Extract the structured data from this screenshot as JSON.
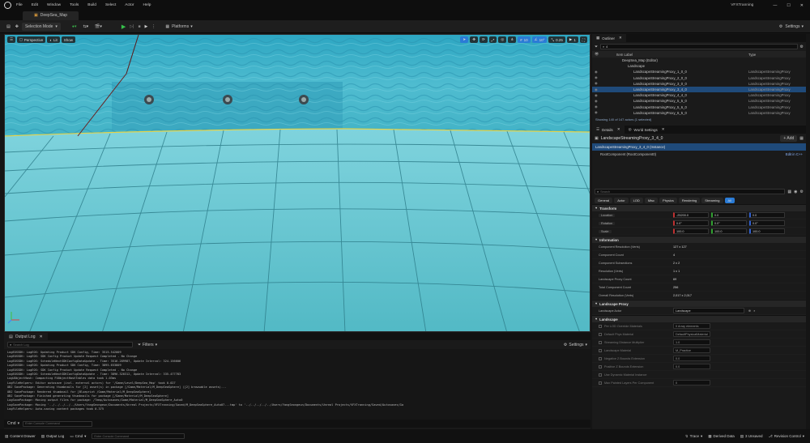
{
  "app": {
    "menu": [
      "File",
      "Edit",
      "Window",
      "Tools",
      "Build",
      "Select",
      "Actor",
      "Help"
    ],
    "project_name": "VFXTranning",
    "level_tab": "DeepSea_Map"
  },
  "toolbar": {
    "selection_mode": "Selection Mode",
    "platforms": "Platforms",
    "settings": "Settings"
  },
  "viewport": {
    "perspective": "Perspective",
    "lit": "Lit",
    "show": "Show",
    "grid_snap": "10",
    "rotation_snap": "10°",
    "scale_snap": "0.25",
    "camera_speed": "1"
  },
  "outliner": {
    "tab": "Outliner",
    "search_value": "4",
    "col_label": "Item Label",
    "col_type": "Type",
    "items": [
      {
        "label": "DeepSea_Map (Editor)",
        "type": "",
        "indent": 1,
        "selected": false
      },
      {
        "label": "Landscape",
        "type": "",
        "indent": 2,
        "selected": false
      },
      {
        "label": "LandscapeStreamingProxy_1_0_0",
        "type": "LandscapeStreamingProxy",
        "indent": 3,
        "selected": false
      },
      {
        "label": "LandscapeStreamingProxy_2_0_0",
        "type": "LandscapeStreamingProxy",
        "indent": 3,
        "selected": false
      },
      {
        "label": "LandscapeStreamingProxy_3_0_0",
        "type": "LandscapeStreamingProxy",
        "indent": 3,
        "selected": false
      },
      {
        "label": "LandscapeStreamingProxy_3_4_0",
        "type": "LandscapeStreamingProxy",
        "indent": 3,
        "selected": true
      },
      {
        "label": "LandscapeStreamingProxy_4_4_0",
        "type": "LandscapeStreamingProxy",
        "indent": 3,
        "selected": false
      },
      {
        "label": "LandscapeStreamingProxy_5_5_0",
        "type": "LandscapeStreamingProxy",
        "indent": 3,
        "selected": false
      },
      {
        "label": "LandscapeStreamingProxy_5_6_0",
        "type": "LandscapeStreamingProxy",
        "indent": 3,
        "selected": false
      },
      {
        "label": "LandscapeStreamingProxy_6_5_0",
        "type": "LandscapeStreamingProxy",
        "indent": 3,
        "selected": false
      }
    ],
    "status": "Showing 140 of 147 actors (1 selected)"
  },
  "details": {
    "tab": "Details",
    "tab2": "World Settings",
    "actor_name": "LandscapeStreamingProxy_3_4_0",
    "add": "+ Add",
    "instance_label": "LandscapeStreamingProxy_3_4_0 (Instance)",
    "root_component": "RootComponent (RootComponent0)",
    "edit_cpp": "Edit in C++",
    "search_placeholder": "Search",
    "filter_tabs": [
      "General",
      "Actor",
      "LOD",
      "Misc",
      "Physics",
      "Rendering",
      "Streaming",
      "All"
    ],
    "transform": {
      "title": "Transform",
      "location_label": "Location",
      "location": [
        "-25200.0",
        "0.0",
        "0.0"
      ],
      "rotation_label": "Rotation",
      "rotation": [
        "0.0°",
        "0.0°",
        "0.0°"
      ],
      "scale_label": "Scale",
      "scale": [
        "100.0",
        "100.0",
        "100.0"
      ]
    },
    "information": {
      "title": "Information",
      "rows": [
        {
          "label": "Component Resolution (Verts)",
          "value": "127 x 127"
        },
        {
          "label": "Component Count",
          "value": "4"
        },
        {
          "label": "Component Subsections",
          "value": "2 x 2"
        },
        {
          "label": "Resolution (Verts)",
          "value": "1 x 1"
        },
        {
          "label": "Landscape Proxy Count",
          "value": "69"
        },
        {
          "label": "Total Component Count",
          "value": "256"
        },
        {
          "label": "Overall Resolution (Verts)",
          "value": "2,017 x 2,017"
        }
      ]
    },
    "landscape_proxy": {
      "title": "Landscape Proxy",
      "actor_label": "Landscape Actor",
      "actor_value": "Landscape"
    },
    "landscape": {
      "title": "Landscape",
      "rows": [
        {
          "label": "Per LOD Override Materials",
          "value": "0 Array elements"
        },
        {
          "label": "Default Phys Material",
          "value": "DefaultPhysicalMaterial"
        },
        {
          "label": "Streaming Distance Multiplier",
          "value": "1.0"
        },
        {
          "label": "Landscape Material",
          "value": "M_Practice"
        },
        {
          "label": "Negative Z Bounds Extension",
          "value": "0.0"
        },
        {
          "label": "Positive Z Bounds Extension",
          "value": "0.0"
        },
        {
          "label": "Use Dynamic Material Instance",
          "value": ""
        },
        {
          "label": "Max Painted Layers Per Component",
          "value": "0"
        }
      ]
    }
  },
  "outputlog": {
    "tab": "Output Log",
    "search_placeholder": "Search Log",
    "filters": "Filters",
    "settings": "Settings",
    "cmd_label": "Cmd",
    "cmd_placeholder": "Enter Console Command",
    "lines": [
      "LogEOSSDK: LogEOS: Updating Product SDK Config, Time: 3515.542009",
      "LogEOSSDK: LogEOS: SDK Config Product Update Request Completed - No Change",
      "LogEOSSDK: LogEOS: ScheduleNextSDKConfigDataUpdate - Time: 3516.289987, Update Interval: 324.156606",
      "LogEOSSDK: LogEOS: Updating Product SDK Config, Time: 3895.653809",
      "LogEOSSDK: LogEOS: SDK Config Product Update Request Completed - No Change",
      "LogEOSSDK: LogEOS: ScheduleNextSDKConfigDataUpdate - Time: 3896.320312, Update Interval: 335.477783",
      "LogUObjectHash: Compacting FUObjectHashTables data took 1.03ms",
      "LogFileHelpers: Editor autosave (incl. external actors) for '/Game/Level/DeepSea_Map' took 0.027",
      "OBJ SavePackage: Generating thumbnails for [2] asset(s) in package [/Game/Material/M_DeepSeaSphere] ([2] browsable assets)...",
      "OBJ SavePackage: Rendered thumbnail for [Blueprint /Game/Material/M_DeepSeaSphere]",
      "OBJ SavePackage: Finished generating thumbnails for package [/Game/Material/M_DeepSeaSphere]",
      "LogSavePackage: Moving output files for package: /Temp/Autosaves/Game/Material/M_DeepSeaSphere_Auto0",
      "LogSavePackage: Moving '../../../../../Users/YangSeongeun/Documents/Unreal Projects/VFXTranning/Saved/M_DeepSeaSphere_Auto07...tmp' to '../../../../../Users/YangSeongeun/Documents/Unreal Projects/VFXTranning/Saved/Autosaves/Ga",
      "LogFileHelpers: Auto-saving content packages took 0.375"
    ]
  },
  "statusbar": {
    "content_drawer": "Content Drawer",
    "output_log": "Output Log",
    "cmd": "Cmd",
    "cmd_placeholder": "Enter Console Command",
    "trace": "Trace",
    "derived_data": "Derived Data",
    "unsaved": "3 Unsaved",
    "revision_control": "Revision Control"
  },
  "colors": {
    "accent_blue": "#2a7bd6",
    "selection": "#1f4a7a",
    "play_green": "#36c24b",
    "water": "#3fb0c6"
  }
}
